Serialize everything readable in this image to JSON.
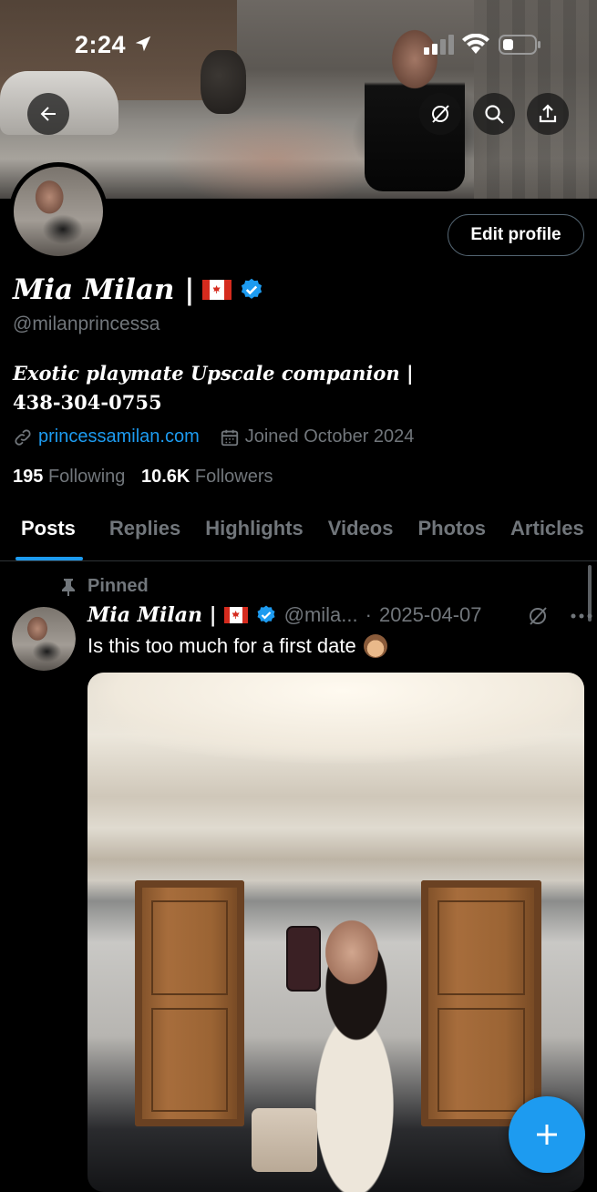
{
  "status_bar": {
    "time": "2:24"
  },
  "profile": {
    "display_name": "Mia Milan |",
    "handle": "@milanprincessa",
    "bio_line1": "Exotic playmate Upscale companion |",
    "bio_phone": "438-304-0755",
    "website": "princessamilan.com",
    "joined": "Joined October 2024",
    "following_count": "195",
    "following_label": "Following",
    "followers_count": "10.6K",
    "followers_label": "Followers",
    "edit_profile_label": "Edit profile",
    "verified_color": "#1d9bf0"
  },
  "tabs": [
    "Posts",
    "Replies",
    "Highlights",
    "Videos",
    "Photos",
    "Articles"
  ],
  "active_tab": "Posts",
  "pinned_post": {
    "pinned_label": "Pinned",
    "author_name": "Mia Milan |",
    "author_handle": "@mila...",
    "separator": "·",
    "date": "2025-04-07",
    "text": "Is this too much for a first date",
    "emoji": "see-no-evil-monkey"
  },
  "icons": {
    "back": "arrow-left-icon",
    "grok": "grok-icon",
    "search": "search-icon",
    "share": "share-icon",
    "link": "link-icon",
    "calendar": "calendar-icon",
    "pin": "pin-icon",
    "more": "more-icon",
    "compose": "plus-icon"
  },
  "colors": {
    "accent": "#1d9bf0",
    "muted": "#71767b",
    "background": "#000000"
  }
}
